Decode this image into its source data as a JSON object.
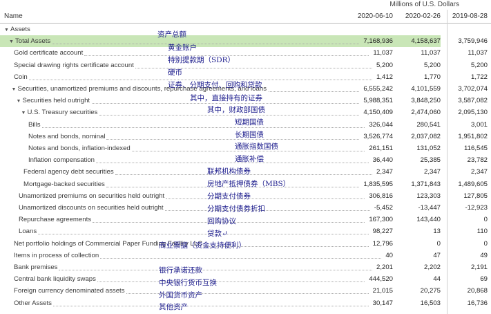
{
  "units_label": "Millions of U.S. Dollars",
  "header": {
    "name": "Name",
    "col1": "2020-06-10",
    "col2": "2020-02-26",
    "col3": "2019-08-28"
  },
  "rows": [
    {
      "label": "Assets",
      "toggle": "▼",
      "indent": 0,
      "values": [
        "",
        "",
        ""
      ]
    },
    {
      "label": "Total Assets",
      "toggle": "▼",
      "indent": 1,
      "highlight": true,
      "values": [
        "7,168,936",
        "4,158,637",
        "3,759,946"
      ]
    },
    {
      "label": "Gold certificate account",
      "toggle": "",
      "indent": 2,
      "values": [
        "11,037",
        "11,037",
        "11,037"
      ]
    },
    {
      "label": "Special drawing rights certificate account",
      "toggle": "",
      "indent": 2,
      "values": [
        "5,200",
        "5,200",
        "5,200"
      ]
    },
    {
      "label": "Coin",
      "toggle": "",
      "indent": 2,
      "values": [
        "1,412",
        "1,770",
        "1,722"
      ]
    },
    {
      "label": "Securities, unamortized premiums and discounts, repurchase agreements, and loans",
      "toggle": "▼",
      "indent": 1.5,
      "values": [
        "6,555,242",
        "4,101,559",
        "3,702,074"
      ]
    },
    {
      "label": "Securities held outright",
      "toggle": "▼",
      "indent": 2.5,
      "values": [
        "5,988,351",
        "3,848,250",
        "3,587,082"
      ]
    },
    {
      "label": "U.S. Treasury securities",
      "toggle": "▼",
      "indent": 3.5,
      "values": [
        "4,150,409",
        "2,474,060",
        "2,095,130"
      ]
    },
    {
      "label": "Bills",
      "toggle": "",
      "indent": 5,
      "values": [
        "326,044",
        "280,541",
        "3,001"
      ]
    },
    {
      "label": "Notes and bonds, nominal",
      "toggle": "",
      "indent": 5,
      "values": [
        "3,526,774",
        "2,037,082",
        "1,951,802"
      ]
    },
    {
      "label": "Notes and bonds, inflation-indexed",
      "toggle": "",
      "indent": 5,
      "values": [
        "261,151",
        "131,052",
        "116,545"
      ]
    },
    {
      "label": "Inflation compensation",
      "toggle": "",
      "indent": 5,
      "values": [
        "36,440",
        "25,385",
        "23,782"
      ]
    },
    {
      "label": "Federal agency debt securities",
      "toggle": "",
      "indent": 4,
      "values": [
        "2,347",
        "2,347",
        "2,347"
      ]
    },
    {
      "label": "Mortgage-backed securities",
      "toggle": "",
      "indent": 4,
      "values": [
        "1,835,595",
        "1,371,843",
        "1,489,605"
      ]
    },
    {
      "label": "Unamortized premiums on securities held outright",
      "toggle": "",
      "indent": 3,
      "values": [
        "306,816",
        "123,303",
        "127,805"
      ]
    },
    {
      "label": "Unamortized discounts on securities held outright",
      "toggle": "",
      "indent": 3,
      "values": [
        "-5,452",
        "-13,447",
        "-12,923"
      ]
    },
    {
      "label": "Repurchase agreements",
      "toggle": "",
      "indent": 3,
      "values": [
        "167,300",
        "143,440",
        "0"
      ]
    },
    {
      "label": "Loans",
      "toggle": "",
      "indent": 3,
      "values": [
        "98,227",
        "13",
        "110"
      ]
    },
    {
      "label": "Net portfolio holdings of Commercial Paper Funding Facility LLC",
      "toggle": "",
      "indent": 2,
      "values": [
        "12,796",
        "0",
        "0"
      ]
    },
    {
      "label": "Items in process of collection",
      "toggle": "",
      "indent": 2,
      "values": [
        "40",
        "47",
        "49"
      ]
    },
    {
      "label": "Bank premises",
      "toggle": "",
      "indent": 2,
      "values": [
        "2,201",
        "2,202",
        "2,191"
      ]
    },
    {
      "label": "Central bank liquidity swaps",
      "toggle": "",
      "indent": 2,
      "values": [
        "444,520",
        "44",
        "69"
      ]
    },
    {
      "label": "Foreign currency denominated assets",
      "toggle": "",
      "indent": 2,
      "values": [
        "21,015",
        "20,275",
        "20,868"
      ]
    },
    {
      "label": "Other Assets",
      "toggle": "",
      "indent": 2,
      "values": [
        "30,147",
        "16,503",
        "16,736"
      ]
    }
  ],
  "annotations": [
    "资产总额",
    "黄金账户",
    "特别提款期（SDR）",
    "硬币",
    "证券、分期支付、回购和贷款",
    "其中，直接持有的证券",
    "其中，财政部国债",
    "短期国债",
    "长期国债",
    "通胀指数国债",
    "通胀补偿",
    "联邦机构债券",
    "房地产抵押债券（MBS）",
    "分期支付债券",
    "分期支付债券折扣",
    "回购协议",
    "贷款↵",
    "商业票据（资金支持便利）",
    "银行承诺还款",
    "中央银行货币互换",
    "外国货币资产",
    "其他资产"
  ]
}
